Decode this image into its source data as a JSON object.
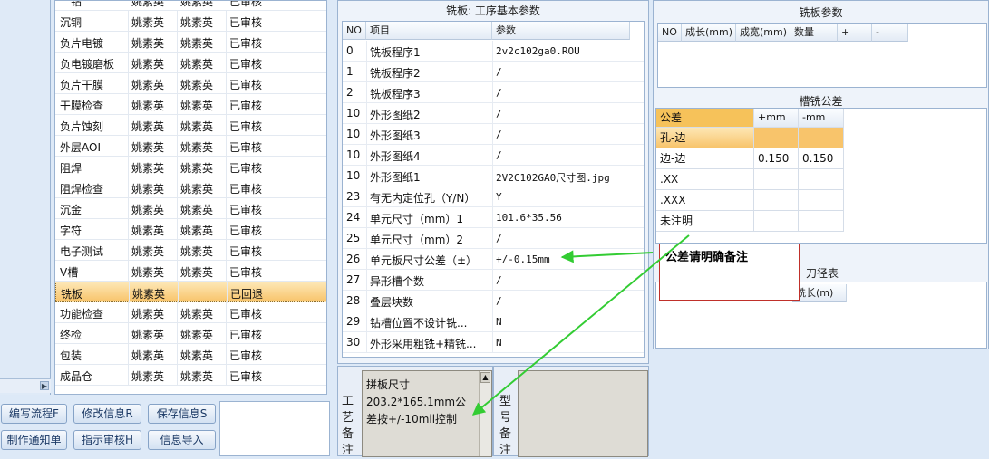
{
  "process_list": {
    "rows": [
      {
        "name": "沉铜",
        "p1": "姚素英",
        "p2": "姚素英",
        "status": "已审核"
      },
      {
        "name": "负片电镀",
        "p1": "姚素英",
        "p2": "姚素英",
        "status": "已审核"
      },
      {
        "name": "负电镀磨板",
        "p1": "姚素英",
        "p2": "姚素英",
        "status": "已审核"
      },
      {
        "name": "负片干膜",
        "p1": "姚素英",
        "p2": "姚素英",
        "status": "已审核"
      },
      {
        "name": "干膜检查",
        "p1": "姚素英",
        "p2": "姚素英",
        "status": "已审核"
      },
      {
        "name": "负片蚀刻",
        "p1": "姚素英",
        "p2": "姚素英",
        "status": "已审核"
      },
      {
        "name": "外层AOI",
        "p1": "姚素英",
        "p2": "姚素英",
        "status": "已审核"
      },
      {
        "name": "阻焊",
        "p1": "姚素英",
        "p2": "姚素英",
        "status": "已审核"
      },
      {
        "name": "阻焊检查",
        "p1": "姚素英",
        "p2": "姚素英",
        "status": "已审核"
      },
      {
        "name": "沉金",
        "p1": "姚素英",
        "p2": "姚素英",
        "status": "已审核"
      },
      {
        "name": "字符",
        "p1": "姚素英",
        "p2": "姚素英",
        "status": "已审核"
      },
      {
        "name": "电子测试",
        "p1": "姚素英",
        "p2": "姚素英",
        "status": "已审核"
      },
      {
        "name": "V槽",
        "p1": "姚素英",
        "p2": "姚素英",
        "status": "已审核"
      },
      {
        "name": "铣板",
        "p1": "姚素英",
        "p2": "",
        "status": "已回退",
        "selected": true
      },
      {
        "name": "功能检查",
        "p1": "姚素英",
        "p2": "姚素英",
        "status": "已审核"
      },
      {
        "name": "终检",
        "p1": "姚素英",
        "p2": "姚素英",
        "status": "已审核"
      },
      {
        "name": "包装",
        "p1": "姚素英",
        "p2": "姚素英",
        "status": "已审核"
      },
      {
        "name": "成品仓",
        "p1": "姚素英",
        "p2": "姚素英",
        "status": "已审核"
      }
    ]
  },
  "buttons": {
    "edit_flow": "编写流程F",
    "modify_info": "修改信息R",
    "save_info": "保存信息S",
    "make_notice": "制作通知单",
    "assign_review": "指示审核H",
    "import_info": "信息导入"
  },
  "basic_params": {
    "title": "铣板: 工序基本参数",
    "headers": {
      "no": "NO",
      "item": "项目",
      "param": "参数"
    },
    "rows": [
      {
        "no": "0",
        "item": "铣板程序1",
        "param": "2v2c102ga0.ROU"
      },
      {
        "no": "1",
        "item": "铣板程序2",
        "param": "/"
      },
      {
        "no": "2",
        "item": "铣板程序3",
        "param": "/"
      },
      {
        "no": "10",
        "item": "外形图纸2",
        "param": "/"
      },
      {
        "no": "10",
        "item": "外形图纸3",
        "param": "/"
      },
      {
        "no": "10",
        "item": "外形图纸4",
        "param": "/"
      },
      {
        "no": "10",
        "item": "外形图纸1",
        "param": "2V2C102GA0尺寸图.jpg"
      },
      {
        "no": "23",
        "item": "有无内定位孔（Y/N）",
        "param": "Y"
      },
      {
        "no": "24",
        "item": "单元尺寸（mm）1",
        "param": "101.6*35.56"
      },
      {
        "no": "25",
        "item": "单元尺寸（mm）2",
        "param": "/"
      },
      {
        "no": "26",
        "item": "单元板尺寸公差（±）",
        "param": "+/-0.15mm"
      },
      {
        "no": "27",
        "item": "异形槽个数",
        "param": "/"
      },
      {
        "no": "28",
        "item": "叠层块数",
        "param": "/"
      },
      {
        "no": "29",
        "item": "钻槽位置不设计铣...",
        "param": "N"
      },
      {
        "no": "30",
        "item": "外形采用粗铣+精铣...",
        "param": "N"
      }
    ]
  },
  "process_notes": {
    "label": "工艺备注",
    "text": "拼板尺寸203.2*165.1mm公差按+/-10mil控制"
  },
  "model_notes": {
    "label": "型号备注",
    "text": ""
  },
  "mill_params": {
    "title": "铣板参数",
    "headers": [
      "NO",
      "成长(mm)",
      "成宽(mm)",
      "数量",
      "+",
      "-"
    ]
  },
  "slot_tolerance": {
    "title": "槽铣公差",
    "headers": [
      "公差",
      "+mm",
      "-mm"
    ],
    "rows": [
      {
        "type": "孔-边",
        "plus": "",
        "minus": ""
      },
      {
        "type": "边-边",
        "plus": "0.150",
        "minus": "0.150"
      },
      {
        "type": ".XX",
        "plus": "",
        "minus": ""
      },
      {
        "type": ".XXX",
        "plus": "",
        "minus": ""
      },
      {
        "type": "未注明",
        "plus": "",
        "minus": ""
      }
    ]
  },
  "tool_table": {
    "title": "刀径表",
    "header_partial": "铣长(m)"
  },
  "callout": {
    "text": "公差请明确备注"
  },
  "colors": {
    "selected_row": "#f8c46b",
    "arrow": "#33cc33",
    "callout_border": "#c0302a",
    "accent_header": "#f6c25a"
  }
}
